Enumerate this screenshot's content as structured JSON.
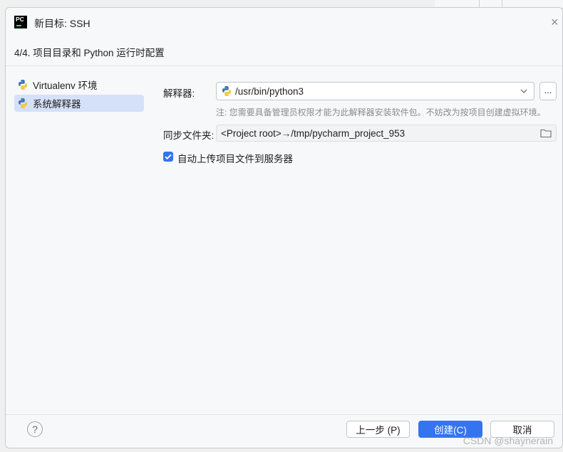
{
  "window": {
    "title": "新目标: SSH",
    "step": "4/4. 项目目录和 Python 运行时配置"
  },
  "sidebar": {
    "items": [
      {
        "label": "Virtualenv 环境",
        "icon": "python-icon",
        "selected": false
      },
      {
        "label": "系统解释器",
        "icon": "python-icon",
        "selected": true
      }
    ]
  },
  "form": {
    "interpreter_label": "解释器:",
    "interpreter_value": "/usr/bin/python3",
    "browse_label": "...",
    "note": "注: 您需要具备管理员权限才能为此解释器安装软件包。不妨改为按项目创建虚拟环境。",
    "sync_label": "同步文件夹:",
    "sync_value": "<Project root>→/tmp/pycharm_project_953",
    "upload_label": "自动上传项目文件到服务器",
    "upload_checked": true
  },
  "footer": {
    "help_label": "?",
    "prev_label": "上一步 (P)",
    "create_label": "创建(C)",
    "cancel_label": "取消"
  },
  "watermark": "CSDN @shaynerain",
  "colors": {
    "accent": "#3574f0",
    "selection": "#d5e1f8",
    "note_text": "#8c8c8c"
  }
}
